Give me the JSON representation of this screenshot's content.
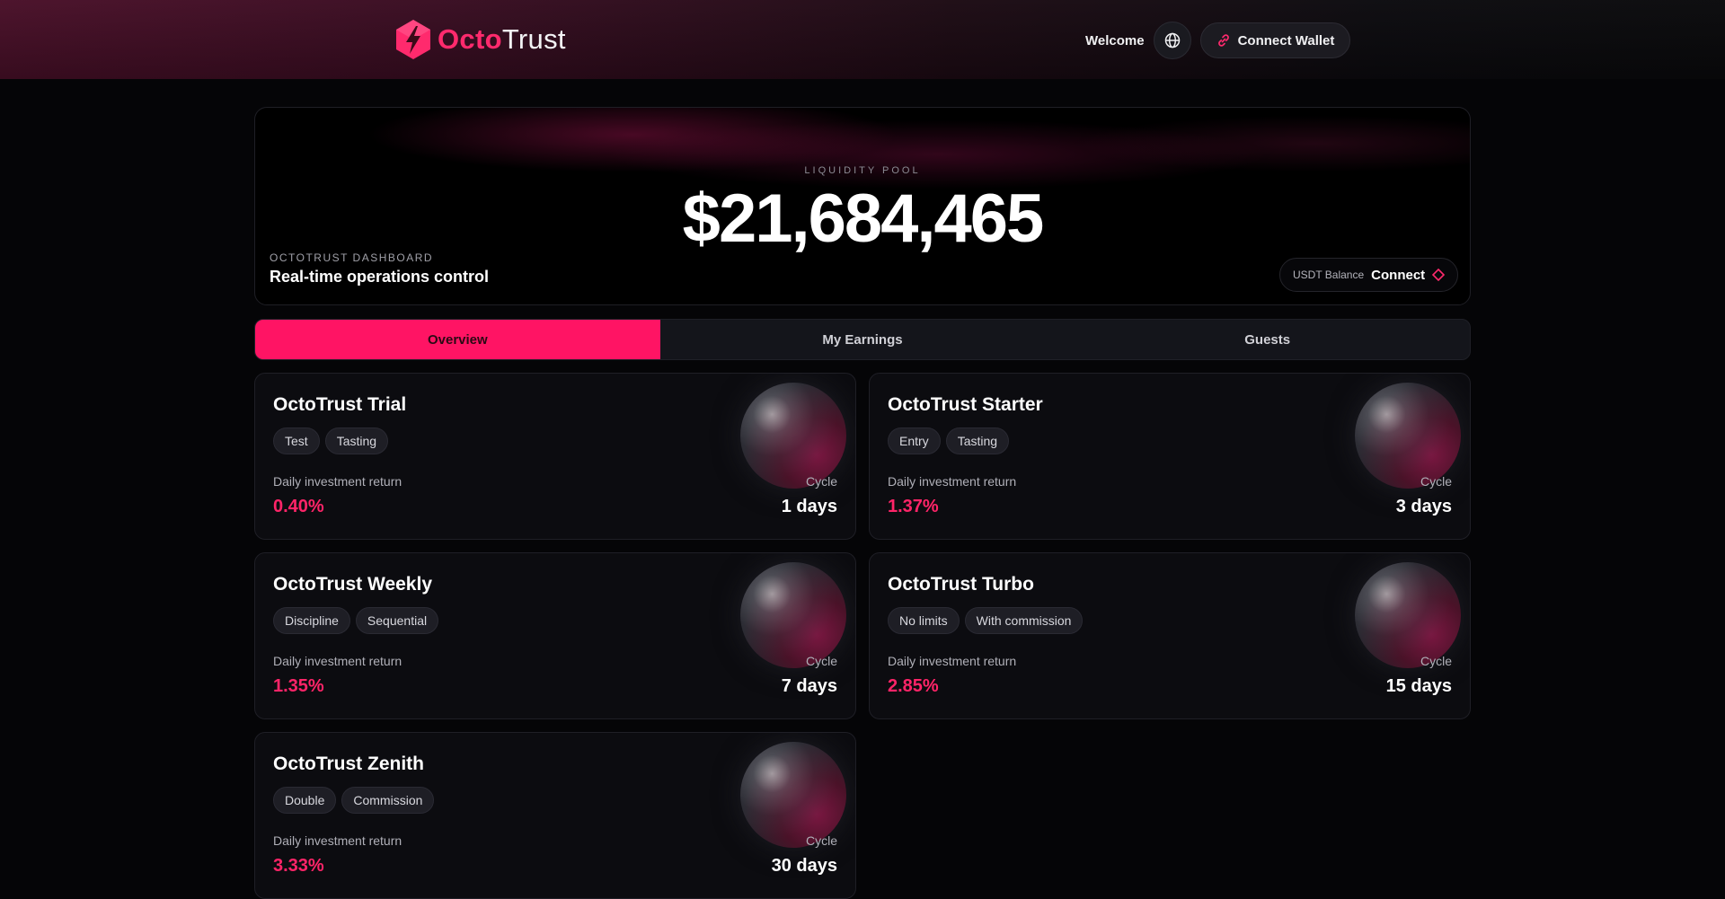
{
  "header": {
    "logo_part1": "Octo",
    "logo_part2": "Trust",
    "welcome": "Welcome",
    "connect_wallet": "Connect Wallet"
  },
  "hero": {
    "pool_label": "LIQUIDITY POOL",
    "pool_value": "$21,684,465",
    "dashboard_label": "OCTOTRUST DASHBOARD",
    "dashboard_title": "Real-time operations control",
    "balance_label": "USDT Balance",
    "balance_action": "Connect"
  },
  "tabs": [
    {
      "label": "Overview",
      "active": true
    },
    {
      "label": "My Earnings",
      "active": false
    },
    {
      "label": "Guests",
      "active": false
    }
  ],
  "plans": [
    {
      "title": "OctoTrust Trial",
      "tags": [
        "Test",
        "Tasting"
      ],
      "return_label": "Daily investment return",
      "return_value": "0.40%",
      "cycle_label": "Cycle",
      "cycle_value": "1 days"
    },
    {
      "title": "OctoTrust Starter",
      "tags": [
        "Entry",
        "Tasting"
      ],
      "return_label": "Daily investment return",
      "return_value": "1.37%",
      "cycle_label": "Cycle",
      "cycle_value": "3 days"
    },
    {
      "title": "OctoTrust Weekly",
      "tags": [
        "Discipline",
        "Sequential"
      ],
      "return_label": "Daily investment return",
      "return_value": "1.35%",
      "cycle_label": "Cycle",
      "cycle_value": "7 days"
    },
    {
      "title": "OctoTrust Turbo",
      "tags": [
        "No limits",
        "With commission"
      ],
      "return_label": "Daily investment return",
      "return_value": "2.85%",
      "cycle_label": "Cycle",
      "cycle_value": "15 days"
    },
    {
      "title": "OctoTrust Zenith",
      "tags": [
        "Double",
        "Commission"
      ],
      "return_label": "Daily investment return",
      "return_value": "3.33%",
      "cycle_label": "Cycle",
      "cycle_value": "30 days"
    }
  ],
  "colors": {
    "accent": "#ff1464",
    "return_value": "#ff2468",
    "background": "#050507",
    "card": "#0c0c10"
  },
  "icons": {
    "logo": "lightning-hexagon-icon",
    "language": "globe-icon",
    "wallet": "link-icon",
    "balance": "diamond-icon"
  }
}
